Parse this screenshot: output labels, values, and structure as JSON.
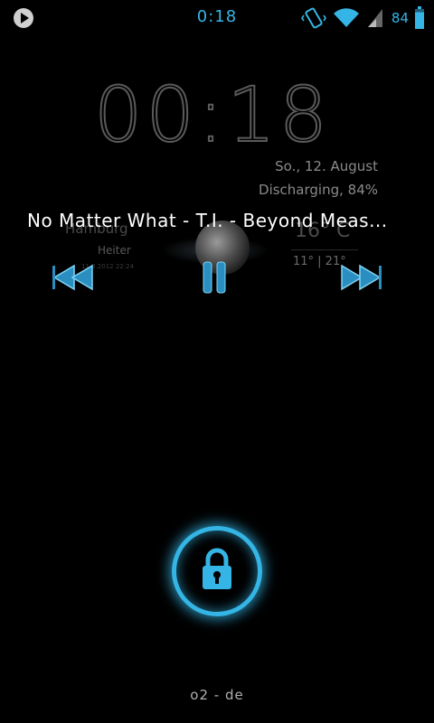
{
  "status_bar": {
    "time": "0:18",
    "battery_text": "84",
    "battery_level_percent": 84,
    "icons": [
      "play-icon",
      "vibrate-icon",
      "wifi-icon",
      "cell-signal-icon",
      "battery-icon"
    ]
  },
  "lockscreen": {
    "clock": "00:18",
    "date": "So., 12. August",
    "battery_status": "Discharging, 84%",
    "carrier": "o2 - de"
  },
  "weather": {
    "city": "Hamburg",
    "condition": "Heiter",
    "timestamp": "11.8.2012 22:24",
    "temperature": "16° C",
    "range": "11° | 21°"
  },
  "music": {
    "song_title": "No Matter What - T.I. - Beyond Meas...",
    "controls": [
      "previous",
      "pause",
      "next"
    ]
  },
  "colors": {
    "accent": "#34b5e5",
    "background": "#000000",
    "dim_text": "#8a8a8a"
  }
}
